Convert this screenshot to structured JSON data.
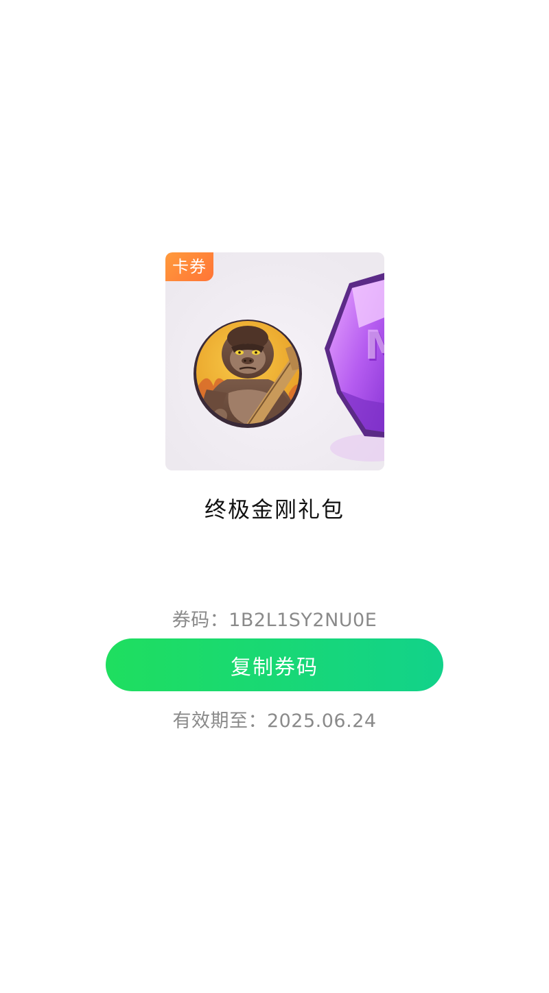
{
  "gift": {
    "tag_label": "卡券",
    "title": "终极金刚礼包",
    "art": {
      "primary_icon": "gorilla-avatar-icon",
      "secondary_icon": "purple-gem-m-icon",
      "secondary_letter": "M"
    }
  },
  "coupon": {
    "code_label": "券码：",
    "code_value": "1B2L1SY2NU0E",
    "copy_button_label": "复制券码",
    "expiry_label": "有效期至：",
    "expiry_value": "2025.06.24"
  },
  "colors": {
    "button_gradient_start": "#1fde5f",
    "button_gradient_end": "#12d28a",
    "tag_color": "#ff7f38",
    "muted_text": "#8a8a8a"
  }
}
